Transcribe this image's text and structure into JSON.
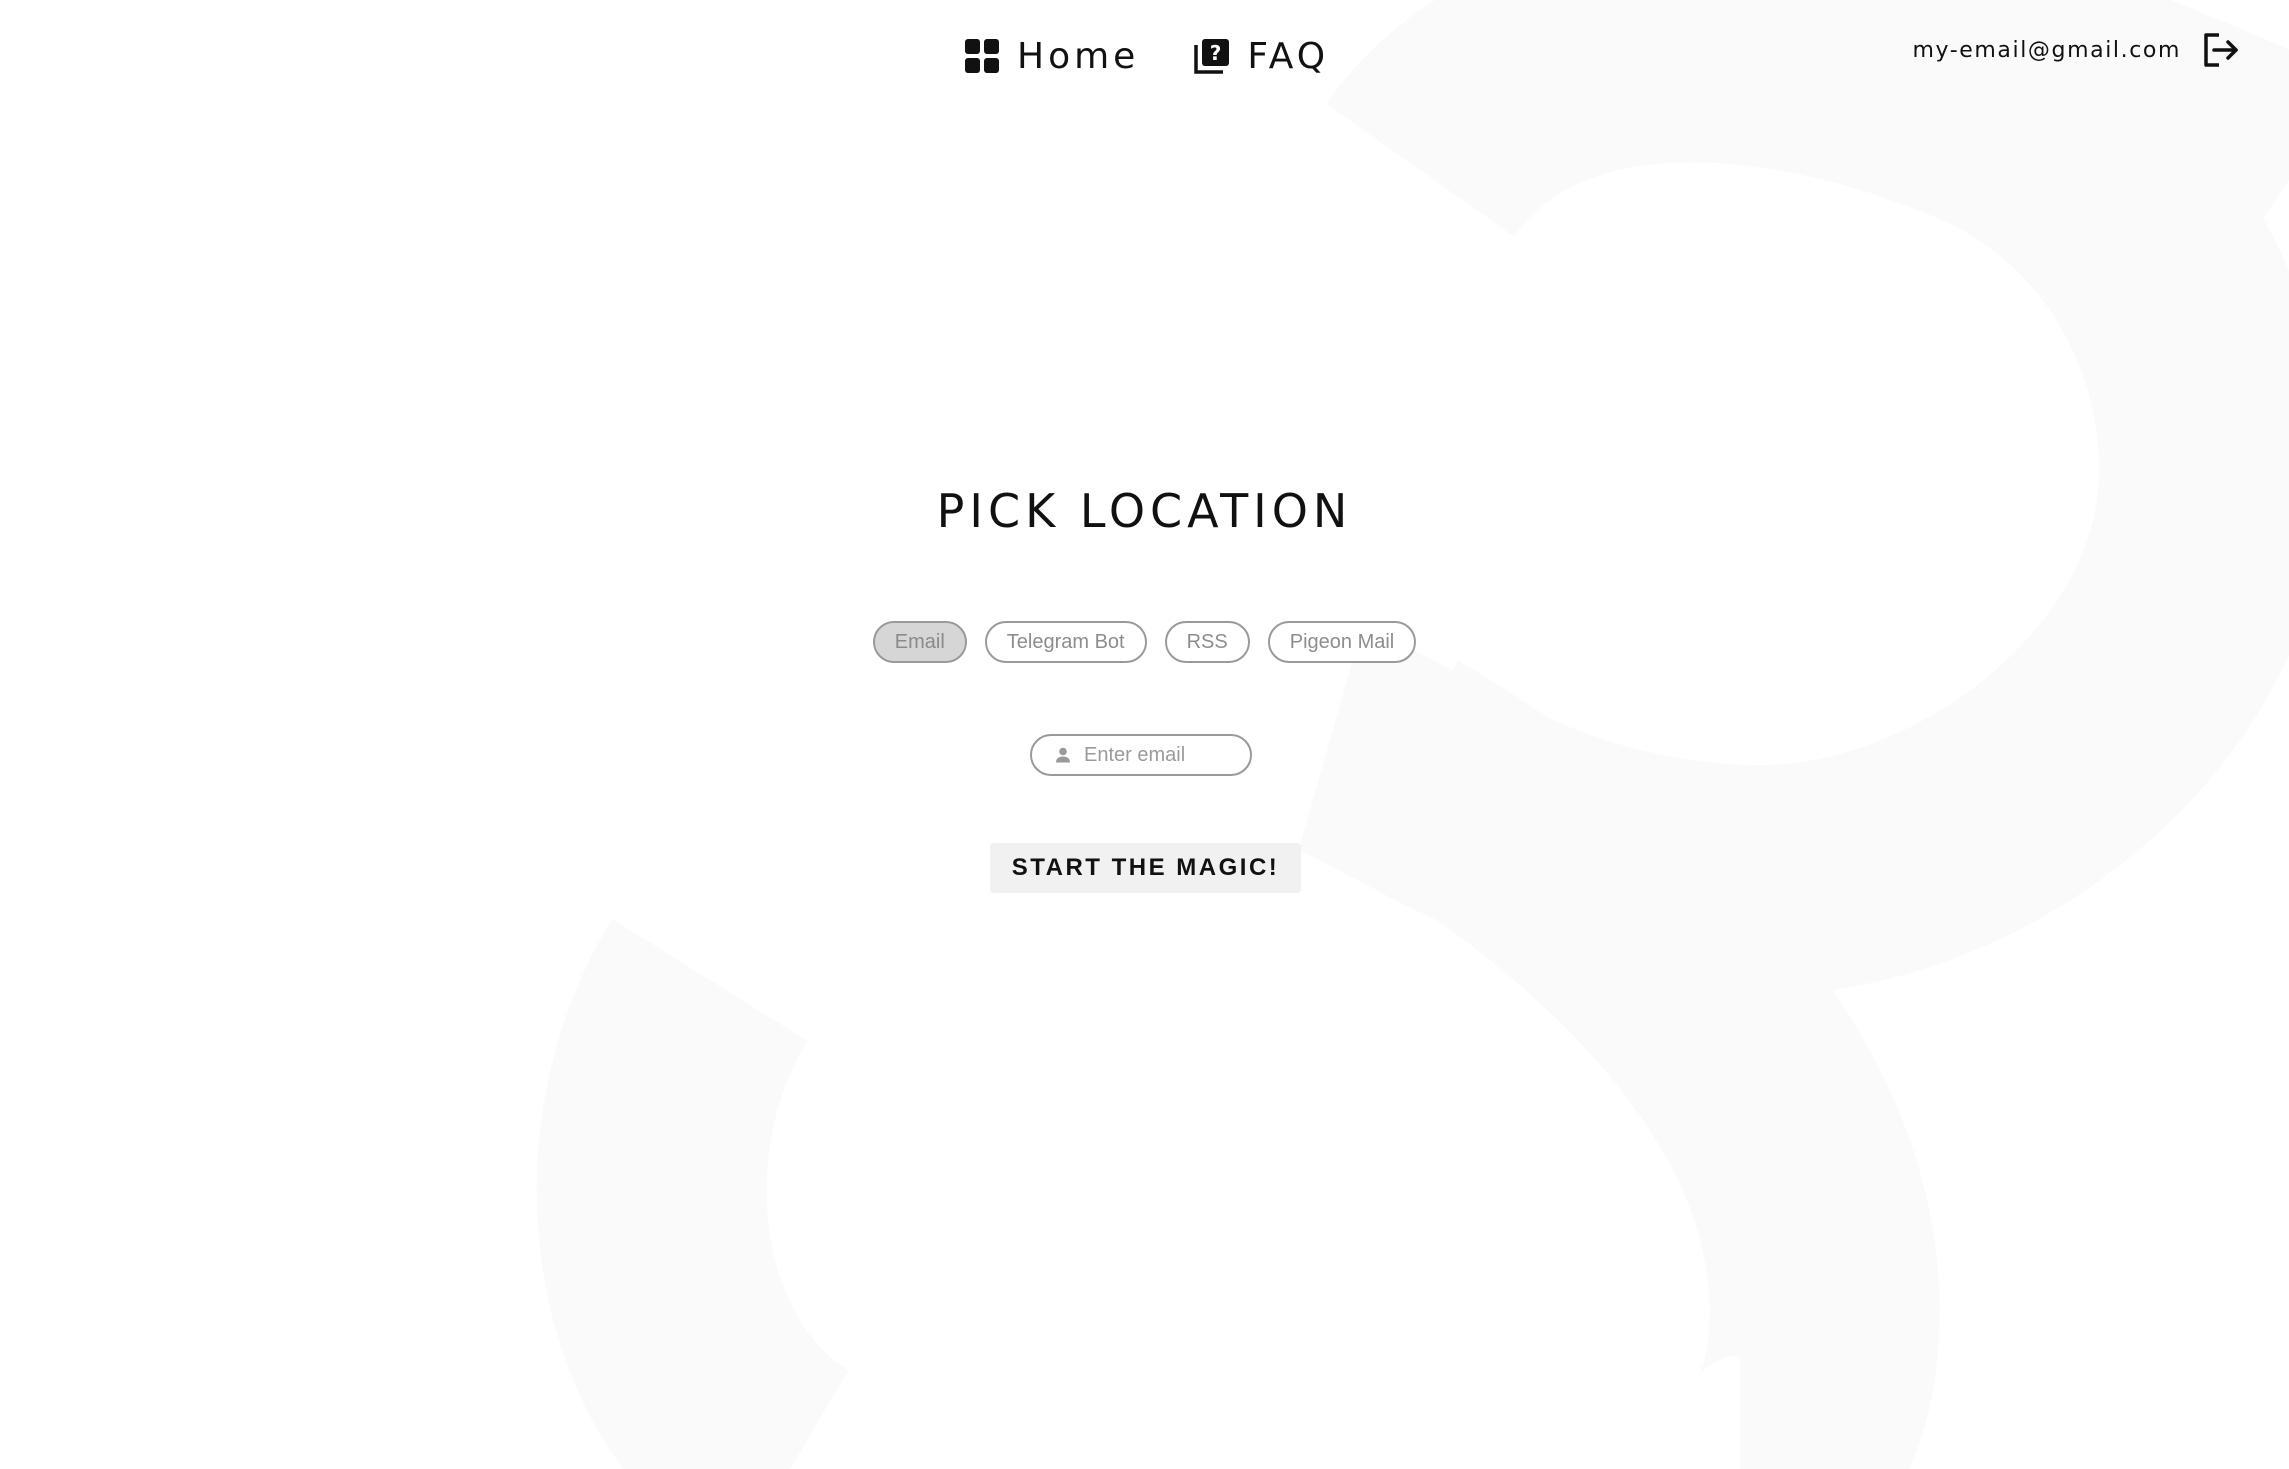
{
  "nav": {
    "items": [
      {
        "label": "Home",
        "icon": "dashboard-icon"
      },
      {
        "label": "FAQ",
        "icon": "help-book-icon"
      }
    ]
  },
  "account": {
    "email": "my-email@gmail.com",
    "logout_icon": "logout-icon"
  },
  "main": {
    "title": "PICK LOCATION",
    "options": [
      {
        "label": "Email",
        "selected": true
      },
      {
        "label": "Telegram Bot",
        "selected": false
      },
      {
        "label": "RSS",
        "selected": false
      },
      {
        "label": "Pigeon Mail",
        "selected": false
      }
    ],
    "input": {
      "placeholder": "Enter email",
      "value": "",
      "icon": "user-icon"
    },
    "submit_label": "START THE MAGIC!"
  },
  "colors": {
    "text": "#111111",
    "pill_border": "#9a9a9a",
    "pill_selected_bg": "#d6d6d6",
    "button_bg": "#f1f1f1",
    "background_shape": "#fafafa"
  }
}
